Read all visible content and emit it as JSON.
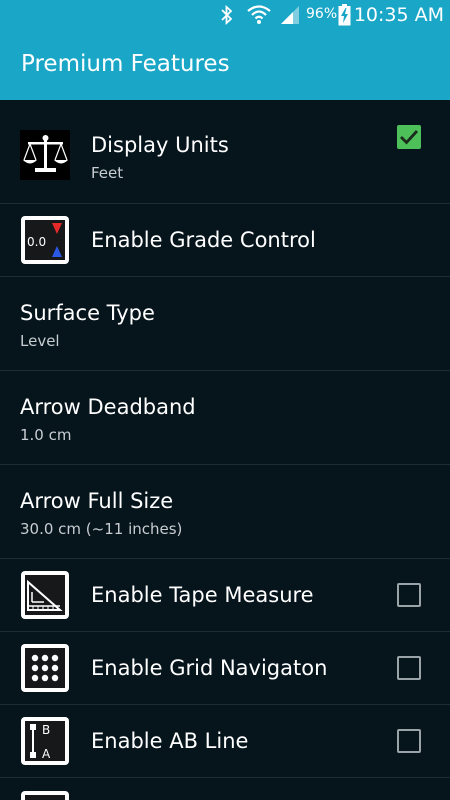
{
  "status_bar": {
    "battery_percent": "96%",
    "time": "10:35 AM",
    "icons": [
      "bluetooth-icon",
      "wifi-icon",
      "signal-icon",
      "battery-charging-icon"
    ]
  },
  "action_bar": {
    "title": "Premium Features"
  },
  "preferences": [
    {
      "title": "Display Units",
      "summary": "Feet",
      "icon": "scale-icon"
    },
    {
      "title": "Enable Grade Control",
      "checked": true,
      "icon": "grade-control-icon",
      "icon_text": "0.0"
    },
    {
      "title": "Surface Type",
      "summary": "Level"
    },
    {
      "title": "Arrow Deadband",
      "summary": "1.0 cm"
    },
    {
      "title": "Arrow Full Size",
      "summary": "30.0 cm (~11 inches)"
    },
    {
      "title": "Enable Tape Measure",
      "checked": false,
      "icon": "tape-measure-icon"
    },
    {
      "title": "Enable Grid Navigaton",
      "checked": false,
      "icon": "grid-icon"
    },
    {
      "title": "Enable AB Line",
      "checked": false,
      "icon": "ab-line-icon",
      "icon_text_a": "A",
      "icon_text_b": "B"
    }
  ],
  "colors": {
    "accent": "#1aa6c7",
    "background": "#06141c",
    "checkbox_checked": "#4ec05a"
  }
}
